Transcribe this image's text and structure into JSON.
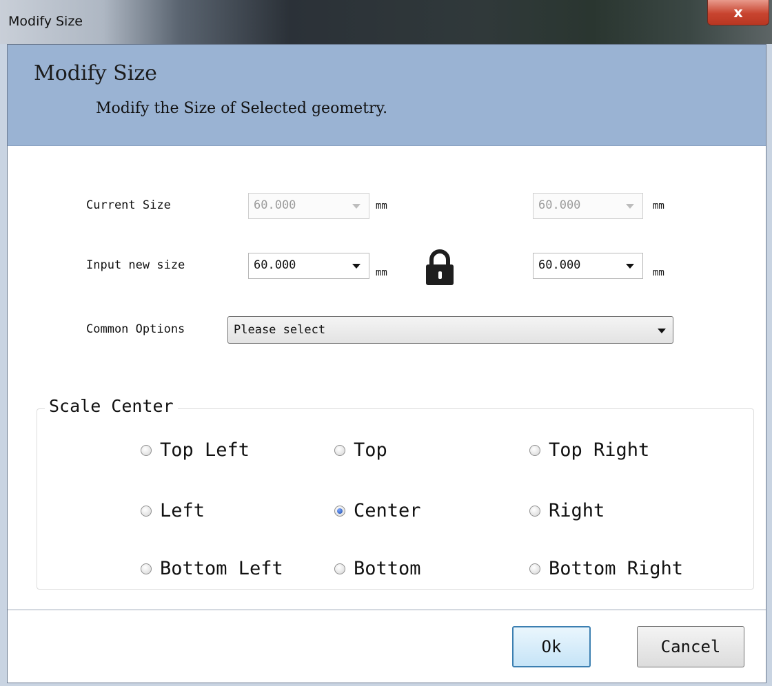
{
  "window": {
    "title": "Modify Size",
    "close_glyph": "x"
  },
  "banner": {
    "title": "Modify Size",
    "subtitle": "Modify the Size of Selected geometry."
  },
  "form": {
    "current_size_label": "Current Size",
    "current_width": "60.000",
    "current_height": "60.000",
    "input_new_size_label": "Input new size",
    "new_width": "60.000",
    "new_height": "60.000",
    "unit": "mm",
    "common_options_label": "Common Options",
    "common_options_value": "Please select"
  },
  "scale_center": {
    "title": "Scale Center",
    "options": [
      {
        "label": "Top Left",
        "checked": false
      },
      {
        "label": "Top",
        "checked": false
      },
      {
        "label": "Top Right",
        "checked": false
      },
      {
        "label": "Left",
        "checked": false
      },
      {
        "label": "Center",
        "checked": true
      },
      {
        "label": "Right",
        "checked": false
      },
      {
        "label": "Bottom Left",
        "checked": false
      },
      {
        "label": "Bottom",
        "checked": false
      },
      {
        "label": "Bottom Right",
        "checked": false
      }
    ]
  },
  "buttons": {
    "ok": "Ok",
    "cancel": "Cancel"
  },
  "icons": {
    "lock": "lock-icon",
    "close": "close-icon"
  },
  "colors": {
    "banner": "#9ab3d3",
    "close": "#c8442f",
    "default_button_border": "#3c7fb1"
  }
}
